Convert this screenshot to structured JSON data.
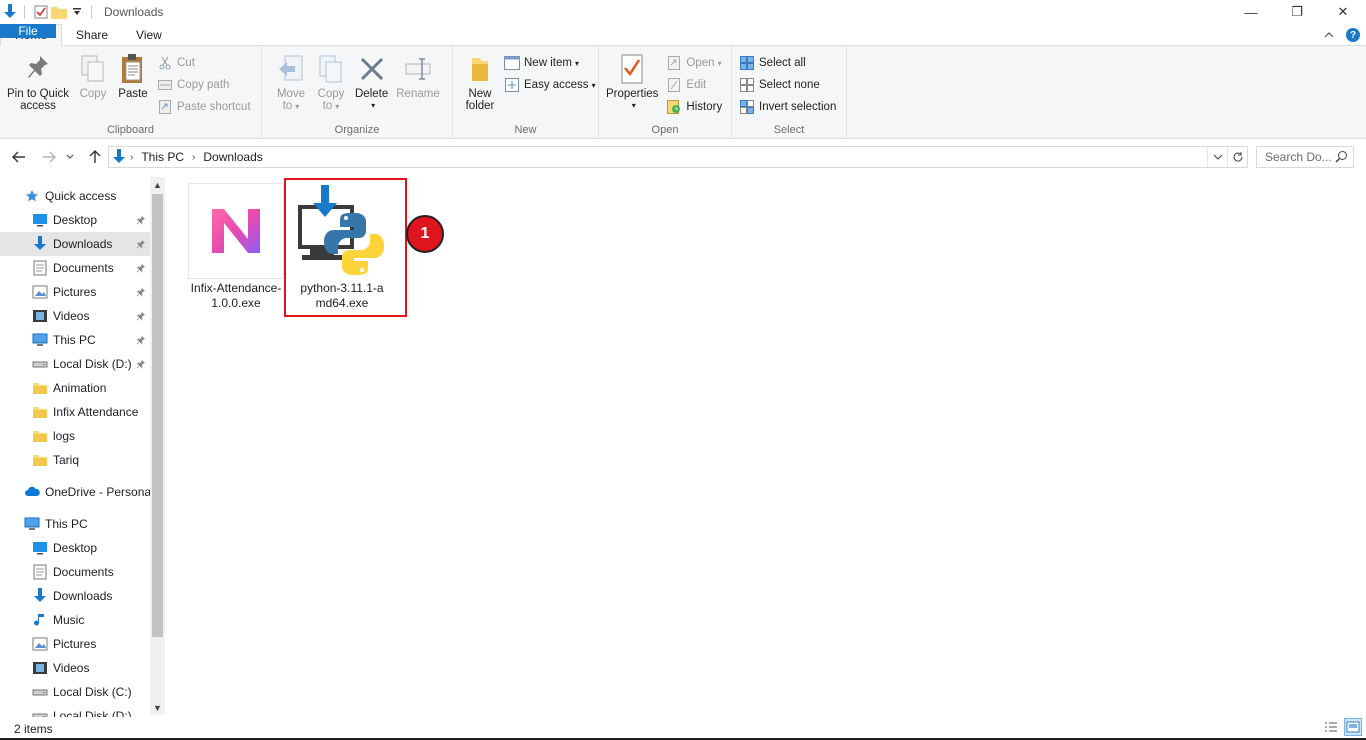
{
  "window": {
    "title": "Downloads",
    "controls": {
      "minimize": "—",
      "restore": "❐",
      "close": "✕"
    }
  },
  "ribbon_tabs": [
    {
      "label": "File"
    },
    {
      "label": "Home"
    },
    {
      "label": "Share"
    },
    {
      "label": "View"
    }
  ],
  "ribbon": {
    "clipboard": {
      "label": "Clipboard",
      "pin_label": "Pin to Quick access",
      "pin_line1": "Pin to Quick",
      "pin_line2": "access",
      "copy": "Copy",
      "paste": "Paste",
      "cut": "Cut",
      "copy_path": "Copy path",
      "paste_shortcut": "Paste shortcut"
    },
    "organize": {
      "label": "Organize",
      "move_to_1": "Move",
      "move_to_2": "to",
      "copy_to_1": "Copy",
      "copy_to_2": "to",
      "delete": "Delete",
      "rename": "Rename"
    },
    "new": {
      "label": "New",
      "new_folder_1": "New",
      "new_folder_2": "folder",
      "new_item": "New item",
      "easy_access": "Easy access"
    },
    "open": {
      "label": "Open",
      "properties": "Properties",
      "open": "Open",
      "edit": "Edit",
      "history": "History"
    },
    "select": {
      "label": "Select",
      "select_all": "Select all",
      "select_none": "Select none",
      "invert_selection": "Invert selection"
    }
  },
  "address": {
    "crumbs": [
      "This PC",
      "Downloads"
    ],
    "search_placeholder": "Search Do..."
  },
  "nav_pane": {
    "items": [
      {
        "label": "Quick access",
        "icon": "star-icon",
        "indent": 0,
        "pinned": false
      },
      {
        "label": "Desktop",
        "icon": "desktop-icon",
        "indent": 1,
        "pinned": true
      },
      {
        "label": "Downloads",
        "icon": "download-arrow-icon",
        "indent": 1,
        "pinned": true,
        "selected": true
      },
      {
        "label": "Documents",
        "icon": "documents-icon",
        "indent": 1,
        "pinned": true
      },
      {
        "label": "Pictures",
        "icon": "pictures-icon",
        "indent": 1,
        "pinned": true
      },
      {
        "label": "Videos",
        "icon": "videos-icon",
        "indent": 1,
        "pinned": true
      },
      {
        "label": "This PC",
        "icon": "computer-icon",
        "indent": 1,
        "pinned": true
      },
      {
        "label": "Local Disk (D:)",
        "icon": "drive-icon",
        "indent": 1,
        "pinned": true
      },
      {
        "label": "Animation",
        "icon": "folder-icon",
        "indent": 1,
        "pinned": false
      },
      {
        "label": "Infix Attendance",
        "icon": "folder-icon",
        "indent": 1,
        "pinned": false
      },
      {
        "label": "logs",
        "icon": "folder-icon",
        "indent": 1,
        "pinned": false
      },
      {
        "label": "Tariq",
        "icon": "folder-icon",
        "indent": 1,
        "pinned": false
      },
      {
        "label": "OneDrive - Personal",
        "icon": "cloud-icon",
        "indent": 0,
        "pinned": false
      },
      {
        "label": "This PC",
        "icon": "computer-icon",
        "indent": 0,
        "pinned": false
      },
      {
        "label": "Desktop",
        "icon": "desktop-icon",
        "indent": 1,
        "pinned": false
      },
      {
        "label": "Documents",
        "icon": "documents-icon",
        "indent": 1,
        "pinned": false
      },
      {
        "label": "Downloads",
        "icon": "download-arrow-icon",
        "indent": 1,
        "pinned": false
      },
      {
        "label": "Music",
        "icon": "music-icon",
        "indent": 1,
        "pinned": false
      },
      {
        "label": "Pictures",
        "icon": "pictures-icon",
        "indent": 1,
        "pinned": false
      },
      {
        "label": "Videos",
        "icon": "videos-icon",
        "indent": 1,
        "pinned": false
      },
      {
        "label": "Local Disk (C:)",
        "icon": "drive-icon",
        "indent": 1,
        "pinned": false
      },
      {
        "label": "Local Disk (D:)",
        "icon": "drive-icon",
        "indent": 1,
        "pinned": false
      }
    ]
  },
  "files": [
    {
      "name": "Infix-Attendance-1.0.0.exe",
      "line1": "Infix-Attendance-",
      "line2": "1.0.0.exe",
      "icon": "infix-app-icon"
    },
    {
      "name": "python-3.11.1-amd64.exe",
      "line1": "python-3.11.1-a",
      "line2": "md64.exe",
      "icon": "python-installer-icon"
    }
  ],
  "annotation": {
    "step": "1"
  },
  "status": {
    "item_count": "2 items"
  },
  "colors": {
    "accent": "#1979ca",
    "highlight": "#e0141d"
  }
}
